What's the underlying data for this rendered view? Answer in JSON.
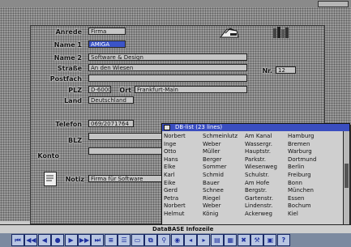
{
  "form": {
    "fields": [
      {
        "label": "Anrede",
        "value": "Firma"
      },
      {
        "label": "Name 1",
        "value": "AMIGA"
      },
      {
        "label": "Name 2",
        "value": "Software & Design"
      },
      {
        "label": "Straße",
        "value": "An den Wiesen"
      },
      {
        "label": "Postfach",
        "value": ""
      },
      {
        "label": "PLZ",
        "value": "D-6000"
      },
      {
        "label": "Ort",
        "value": "Frankfurt-Main"
      },
      {
        "label": "Land",
        "value": "Deutschland"
      },
      {
        "label": "Telefon",
        "value": "069/2071764"
      },
      {
        "label": "BLZ",
        "value": ""
      },
      {
        "label": "Konto",
        "value": ""
      },
      {
        "label": "Notiz",
        "value": "Firma für Software"
      },
      {
        "label": "Nr.",
        "value": "12"
      }
    ]
  },
  "list_window": {
    "title": "DB-list (23 lines)",
    "rows": [
      [
        "Norbert",
        "Schmeinlutz",
        "Am Kanal",
        "Hamburg"
      ],
      [
        "Inge",
        "Weber",
        "Wassergr.",
        "Bremen"
      ],
      [
        "Otto",
        "Müller",
        "Hauptstr.",
        "Warburg"
      ],
      [
        "Hans",
        "Berger",
        "Parkstr.",
        "Dortmund"
      ],
      [
        "Elke",
        "Sommer",
        "Wiesenweg",
        "Berlin"
      ],
      [
        "Karl",
        "Schmid",
        "Schulstr.",
        "Freiburg"
      ],
      [
        "Eike",
        "Bauer",
        "Am Hofe",
        "Bonn"
      ],
      [
        "Gerd",
        "Schnee",
        "Bergstr.",
        "München"
      ],
      [
        "Petra",
        "Riegel",
        "Gartenstr.",
        "Essen"
      ],
      [
        "Norbert",
        "Weber",
        "Lindenstr.",
        "Bochum"
      ],
      [
        "Helmut",
        "König",
        "Ackerweg",
        "Kiel"
      ]
    ]
  },
  "infobar": {
    "text": "DataBASE Infozeile"
  },
  "toolbar": {
    "buttons": [
      {
        "icon": "first-record-icon",
        "glyph": "⏮"
      },
      {
        "icon": "previous-page-icon",
        "glyph": "◀◀"
      },
      {
        "icon": "previous-record-icon",
        "glyph": "◀"
      },
      {
        "icon": "stop-icon",
        "glyph": "●"
      },
      {
        "icon": "next-record-icon",
        "glyph": "▶"
      },
      {
        "icon": "next-page-icon",
        "glyph": "▶▶"
      },
      {
        "icon": "last-record-icon",
        "glyph": "⏭"
      },
      {
        "icon": "edit-icon",
        "glyph": "≡"
      },
      {
        "icon": "list-icon",
        "glyph": "☰"
      },
      {
        "icon": "insert-icon",
        "glyph": "▭"
      },
      {
        "icon": "copy-icon",
        "glyph": "⧉"
      },
      {
        "icon": "search-icon",
        "glyph": "⚲"
      },
      {
        "icon": "filter-icon",
        "glyph": "◉"
      },
      {
        "icon": "arrow-left-icon",
        "glyph": "◂"
      },
      {
        "icon": "arrow-right-icon",
        "glyph": "▸"
      },
      {
        "icon": "sort-icon",
        "glyph": "▤"
      },
      {
        "icon": "print-icon",
        "glyph": "▦"
      },
      {
        "icon": "delete-icon",
        "glyph": "✖"
      },
      {
        "icon": "tools-icon",
        "glyph": "⚒"
      },
      {
        "icon": "save-icon",
        "glyph": "▣"
      },
      {
        "icon": "help-icon",
        "glyph": "?"
      }
    ]
  },
  "colors": {
    "accent": "#3a4ec0",
    "selection": "#3b54c8"
  }
}
